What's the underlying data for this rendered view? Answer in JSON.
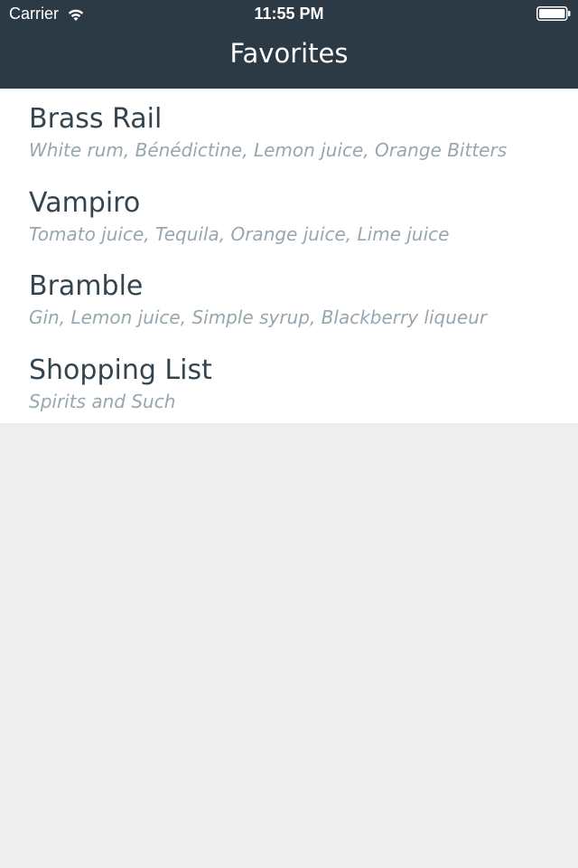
{
  "status_bar": {
    "carrier": "Carrier",
    "time": "11:55 PM",
    "wifi_icon": "wifi-icon",
    "battery_icon": "battery-icon"
  },
  "nav": {
    "title": "Favorites",
    "background_color": "#2c3a46"
  },
  "favorites": [
    {
      "title": "Brass Rail",
      "subtitle": "White rum, Bénédictine, Lemon juice, Orange Bitters"
    },
    {
      "title": "Vampiro",
      "subtitle": "Tomato juice, Tequila, Orange juice, Lime juice"
    },
    {
      "title": "Bramble",
      "subtitle": "Gin, Lemon juice, Simple syrup, Blackberry liqueur"
    },
    {
      "title": "Shopping List",
      "subtitle": "Spirits and Such"
    }
  ],
  "colors": {
    "title_text": "#34454f",
    "subtitle_text": "#98a7af",
    "background": "#eeeeee"
  }
}
